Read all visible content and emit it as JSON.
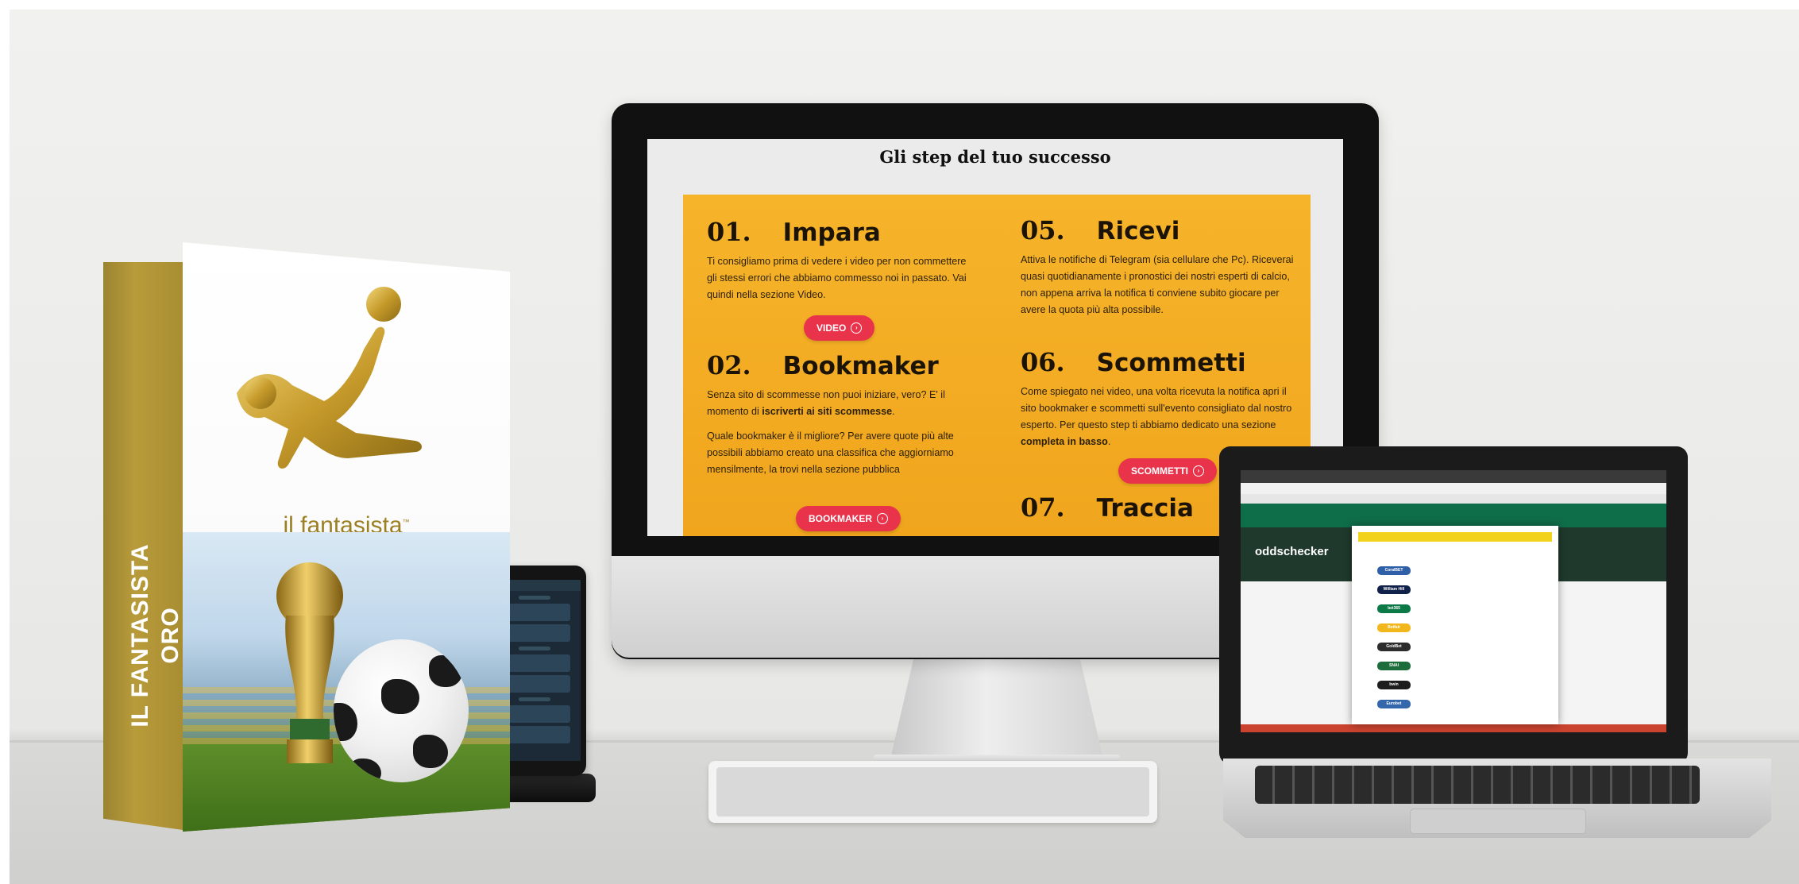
{
  "box": {
    "spine_line1": "IL FANTASISTA",
    "spine_line2": "ORO",
    "brand": "il fantasista",
    "brand_mark": "™",
    "icon": "gold-bicycle-kick-player-icon"
  },
  "imac": {
    "heading": "Gli step del tuo successo",
    "steps": [
      {
        "number": "01.",
        "title": "Impara",
        "body": "Ti consigliamo prima di vedere i video per non commettere gli stessi errori che abbiamo commesso noi in passato. Vai quindi nella sezione Video.",
        "button": "VIDEO"
      },
      {
        "number": "02.",
        "title": "Bookmaker",
        "body1_pre": "Senza sito di scommesse non puoi iniziare, vero? E' il momento di ",
        "body1_bold": "iscriverti ai siti scommesse",
        "body1_post": ".",
        "body2": "Quale bookmaker è il migliore? Per avere quote più alte possibili abbiamo creato una classifica che aggiorniamo mensilmente, la trovi nella sezione pubblica",
        "button": "BOOKMAKER"
      },
      {
        "number": "05.",
        "title": "Ricevi",
        "body": "Attiva le notifiche di Telegram (sia cellulare che Pc). Riceverai quasi quotidianamente i pronostici dei nostri esperti di calcio, non appena arriva la notifica ti conviene subito giocare per avere la quota più alta possibile."
      },
      {
        "number": "06.",
        "title": "Scommetti",
        "body_pre": "Come spiegato nei video, una volta ricevuta la notifica apri il sito bookmaker e scommetti sull'evento consigliato dal nostro esperto. Per questo step ti abbiamo dedicato una sezione ",
        "body_bold": "completa in basso",
        "body_post": ".",
        "button": "SCOMMETTI"
      },
      {
        "number": "07.",
        "title": "Traccia"
      }
    ],
    "button_icon": "circle-arrow-right-icon"
  },
  "laptop": {
    "site_logo": "oddschecker",
    "bookmakers": [
      {
        "name": "CoralBET",
        "color": "#2f5fa7"
      },
      {
        "name": "William Hill",
        "color": "#10224a"
      },
      {
        "name": "bet365",
        "color": "#0c7a47"
      },
      {
        "name": "Betfair",
        "color": "#f2b71c"
      },
      {
        "name": "GoldBet",
        "color": "#2d2d2d"
      },
      {
        "name": "SNAI",
        "color": "#1c6d3b"
      },
      {
        "name": "bwin",
        "color": "#1d1d1d"
      },
      {
        "name": "Eurobet",
        "color": "#3366aa"
      }
    ]
  },
  "colors": {
    "panel": "#f0a51d",
    "cta": "#e8334b",
    "gold": "#b89b3a"
  }
}
